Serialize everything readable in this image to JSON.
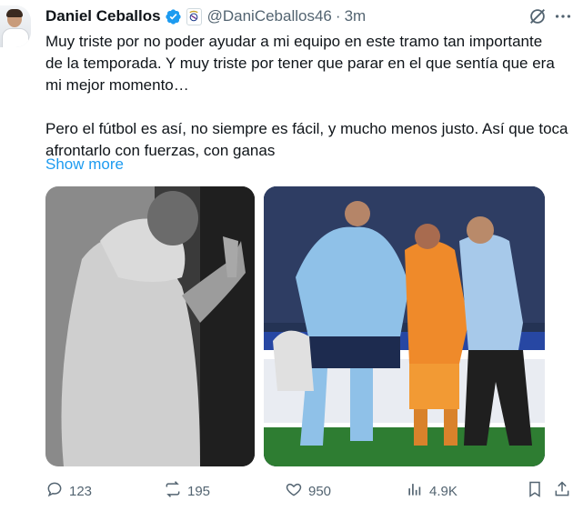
{
  "author": {
    "display_name": "Daniel Ceballos",
    "handle": "@DaniCeballos46",
    "separator": "·",
    "time": "3m"
  },
  "tweet": {
    "text": "Muy triste por no poder ayudar a mi equipo en este tramo tan importante\nde la temporada. Y muy triste por tener que parar en el que sentía que era\nmi mejor momento…\n\nPero el fútbol es así, no siempre es fácil, y mucho menos justo. Así que toca\nafrontarlo con fuerzas, con ganas",
    "show_more": "Show more"
  },
  "media": [
    {
      "description_tag": "grayscale-player-praying-photo"
    },
    {
      "description_tag": "injured-player-helped-off-pitch-photo"
    }
  ],
  "actions": {
    "replies": "123",
    "reposts": "195",
    "likes": "950",
    "views": "4.9K"
  },
  "colors": {
    "text": "#0f1419",
    "secondary": "#536471",
    "accent": "#1d9bf0",
    "verified": "#1d9bf0"
  },
  "icons": [
    "verified-badge-icon",
    "real-madrid-crest-icon",
    "grok-icon",
    "more-icon",
    "reply-icon",
    "repost-icon",
    "like-icon",
    "views-icon",
    "bookmark-icon",
    "share-icon"
  ]
}
